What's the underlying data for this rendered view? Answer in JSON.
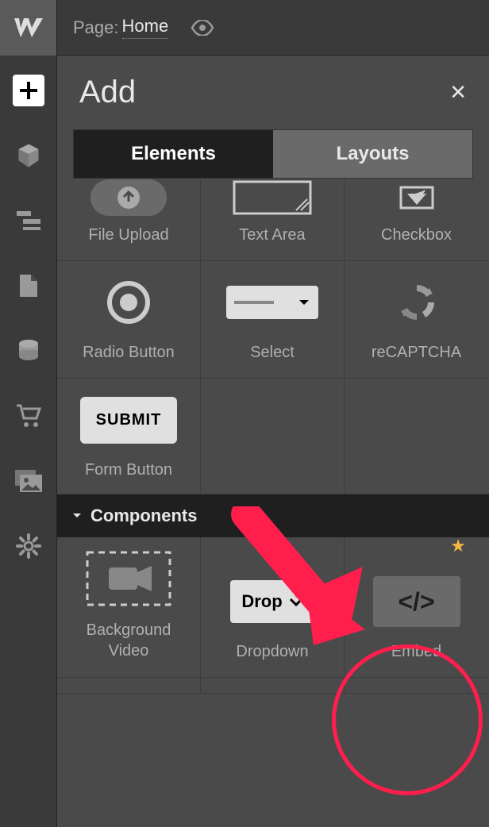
{
  "topbar": {
    "page_label": "Page:",
    "page_name": "Home"
  },
  "panel": {
    "title": "Add",
    "tabs": {
      "elements": "Elements",
      "layouts": "Layouts"
    }
  },
  "elements": {
    "file_upload": "File Upload",
    "text_area": "Text Area",
    "checkbox": "Checkbox",
    "radio_button": "Radio Button",
    "select": "Select",
    "recaptcha": "reCAPTCHA",
    "form_button": "Form Button",
    "form_button_text": "SUBMIT"
  },
  "section_components": "Components",
  "components": {
    "background_video": "Background Video",
    "dropdown": "Dropdown",
    "dropdown_text": "Drop",
    "embed": "Embed"
  }
}
